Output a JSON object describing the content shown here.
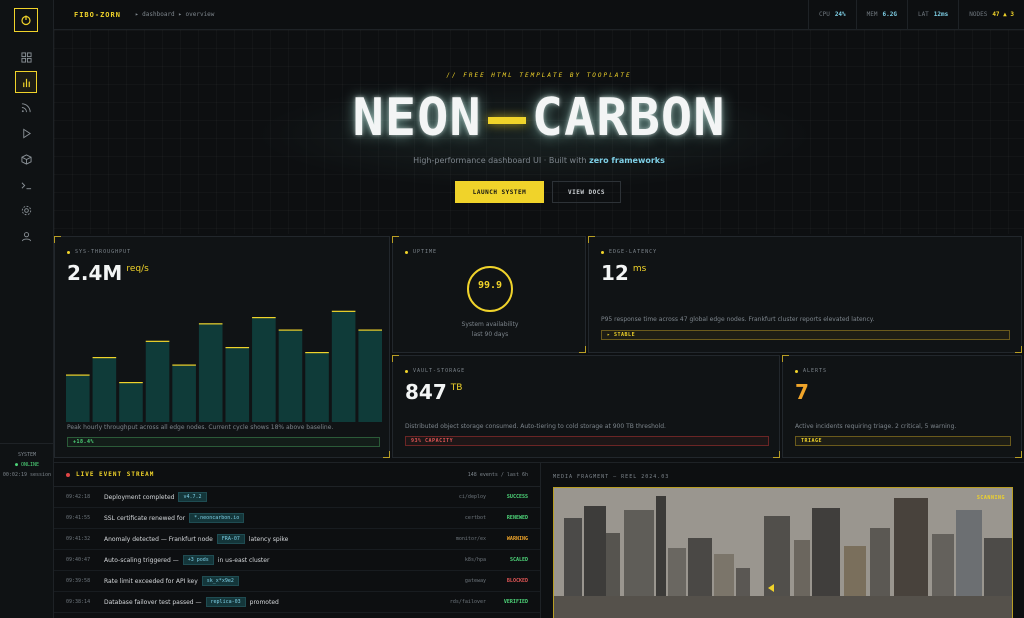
{
  "topbar": {
    "brand": "FIBO-ZORN",
    "breadcrumb": "▸ dashboard ▸ overview",
    "stats": [
      {
        "label": "CPU",
        "value": "24%"
      },
      {
        "label": "MEM",
        "value": "6.2G"
      },
      {
        "label": "LAT",
        "value": "12ms"
      },
      {
        "label": "NODES",
        "value": "47 ▲ 3"
      }
    ]
  },
  "sidebar": {
    "icons": [
      "grid-icon",
      "chart-icon",
      "feed-icon",
      "play-icon",
      "cube-icon",
      "terminal-icon",
      "settings-icon",
      "user-icon"
    ],
    "status_title": "SYSTEM",
    "status_online": "● ONLINE",
    "session": "00:02:19 session"
  },
  "hero": {
    "tagline": "// FREE HTML TEMPLATE BY TOOPLATE",
    "title_left": "NEON",
    "title_right": "CARBON",
    "subtitle_pre": "High-performance dashboard UI · Built with",
    "subtitle_bold": "zero frameworks",
    "launch_label": "LAUNCH SYSTEM",
    "docs_label": "VIEW DOCS"
  },
  "cards": {
    "throughput": {
      "label": "SYS-THROUGHPUT",
      "value": "2.4M",
      "unit": "req/s",
      "desc": "Peak hourly throughput across all edge nodes. Current cycle shows 18% above baseline.",
      "tag": "+18.4%",
      "bars": [
        0.38,
        0.52,
        0.32,
        0.65,
        0.46,
        0.79,
        0.6,
        0.84,
        0.74,
        0.56,
        0.89,
        0.74
      ]
    },
    "uptime": {
      "label": "UPTIME",
      "value": "99.9",
      "percent": 99.9,
      "desc1": "System availability",
      "desc2": "last 90 days"
    },
    "latency": {
      "label": "EDGE-LATENCY",
      "value": "12",
      "unit": "ms",
      "desc": "P95 response time across 47 global edge nodes. Frankfurt cluster reports elevated latency.",
      "tag": "▸ STABLE"
    },
    "storage": {
      "label": "VAULT-STORAGE",
      "value": "847",
      "unit": "TB",
      "desc": "Distributed object storage consumed. Auto-tiering to cold storage at 900 TB threshold.",
      "tag": "93% CAPACITY"
    },
    "alerts": {
      "label": "ALERTS",
      "value": "7",
      "desc": "Active incidents requiring triage. 2 critical, 5 warning.",
      "tag": "TRIAGE"
    }
  },
  "events": {
    "title": "LIVE EVENT STREAM",
    "meta": "148 events / last 6h",
    "rows": [
      {
        "time": "09:42:18",
        "pre": "Deployment completed",
        "chip": "v4.7.2",
        "post": "",
        "src": "ci/deploy",
        "status": "SUCCESS",
        "color": "#4ed67a"
      },
      {
        "time": "09:41:55",
        "pre": "SSL certificate renewed for",
        "chip": "*.neoncarbon.io",
        "post": "",
        "src": "certbot",
        "status": "RENEWED",
        "color": "#4ed67a"
      },
      {
        "time": "09:41:32",
        "pre": "Anomaly detected — Frankfurt node",
        "chip": "FRA-07",
        "post": "latency spike",
        "src": "monitor/ex",
        "status": "WARNING",
        "color": "#f0a52a"
      },
      {
        "time": "09:40:47",
        "pre": "Auto-scaling triggered —",
        "chip": "+3 pods",
        "post": "in us-east cluster",
        "src": "k8s/hpa",
        "status": "SCALED",
        "color": "#4ed67a"
      },
      {
        "time": "09:39:58",
        "pre": "Rate limit exceeded for API key",
        "chip": "sk_x*x9e2",
        "post": "",
        "src": "gateway",
        "status": "BLOCKED",
        "color": "#e05555"
      },
      {
        "time": "09:38:14",
        "pre": "Database failover test passed —",
        "chip": "replica-03",
        "post": "promoted",
        "src": "rds/failover",
        "status": "VERIFIED",
        "color": "#4ed67a"
      }
    ]
  },
  "media": {
    "title": "MEDIA FRAGMENT — REEL 2024.03",
    "badge": "SCANNING"
  }
}
